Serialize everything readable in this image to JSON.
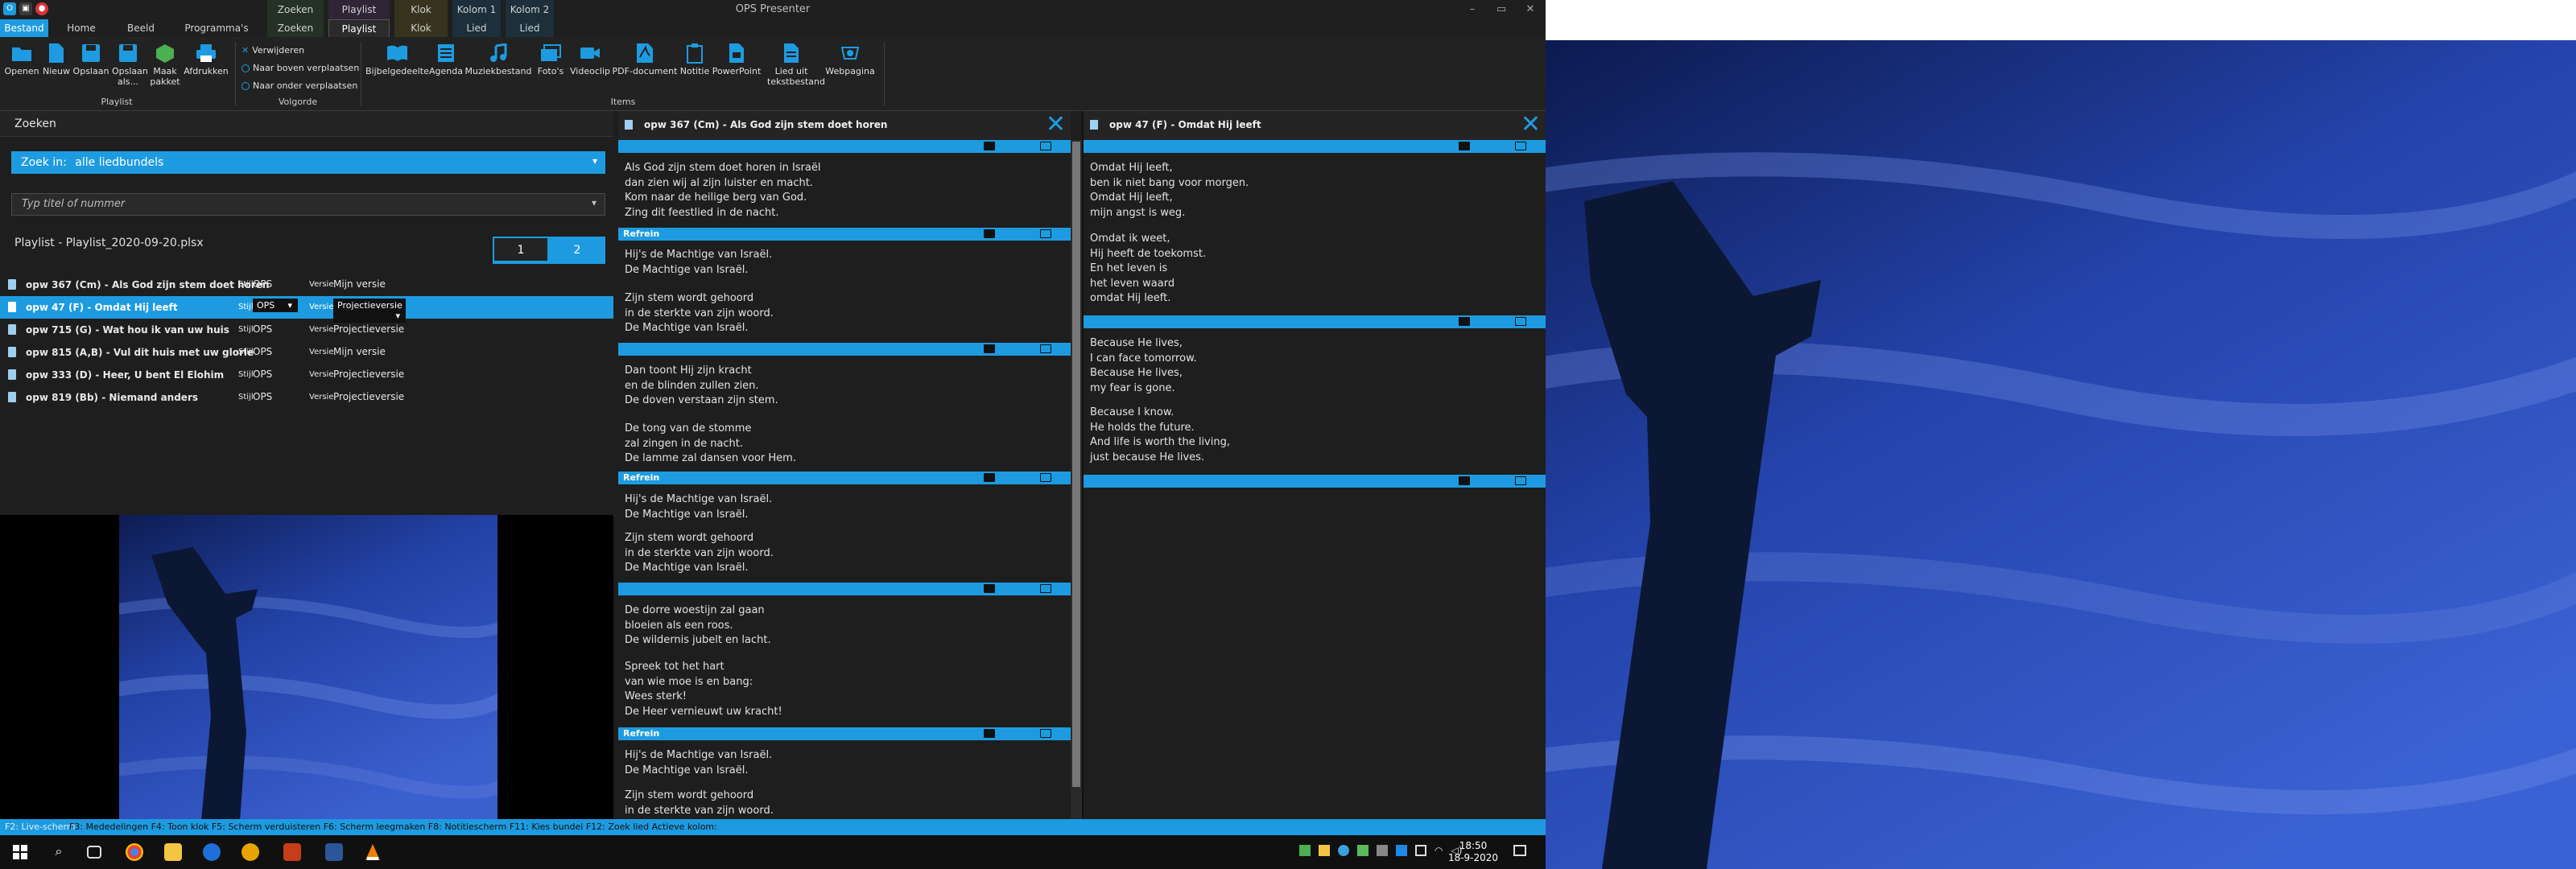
{
  "window": {
    "title": "OPS Presenter",
    "file_tab": "Bestand",
    "tabs": [
      "Home",
      "Beeld",
      "Programma's"
    ],
    "context_groups": [
      {
        "label": "Zoeken",
        "tab": "Zoeken"
      },
      {
        "label": "Playlist",
        "tab": "Playlist"
      },
      {
        "label": "Klok",
        "tab": "Klok"
      },
      {
        "label": "Kolom 1",
        "tab": "Lied"
      },
      {
        "label": "Kolom 2",
        "tab": "Lied"
      }
    ]
  },
  "ribbon": {
    "playlist_group": {
      "buttons": [
        "Openen",
        "Nieuw",
        "Opslaan",
        "Opslaan als...",
        "Maak pakket",
        "Afdrukken"
      ],
      "label": "Playlist"
    },
    "volgorde_group": {
      "buttons": [
        "Verwijderen",
        "Naar boven verplaatsen",
        "Naar onder verplaatsen"
      ],
      "label": "Volgorde"
    },
    "items_group": {
      "buttons": [
        "Bijbelgedeelte",
        "Agenda",
        "Muziekbestand",
        "Foto's",
        "Videoclip",
        "PDF-document",
        "Notitie",
        "PowerPoint",
        "Lied uit tekstbestand",
        "Webpagina"
      ],
      "label": "Items"
    }
  },
  "left_panel": {
    "header": "Zoeken",
    "zoek_in_label": "Zoek in:",
    "zoek_in_value": "alle liedbundels",
    "search_placeholder": "Typ titel of nummer",
    "playlist_title": "Playlist - Playlist_2020-09-20.plsx",
    "pages": [
      "1",
      "2"
    ],
    "stijl_label": "Stijl",
    "versie_label": "Versie",
    "items": [
      {
        "title": "opw 367 (Cm) - Als God zijn stem doet horen",
        "stijl": "OPS",
        "versie": "Mijn versie",
        "selected": false
      },
      {
        "title": "opw 47 (F) - Omdat Hij leeft",
        "stijl": "OPS",
        "versie": "Projectieversie",
        "selected": true
      },
      {
        "title": "opw 715 (G) - Wat hou ik van uw huis",
        "stijl": "OPS",
        "versie": "Projectieversie",
        "selected": false
      },
      {
        "title": "opw 815 (A,B) - Vul dit huis met uw glorie",
        "stijl": "OPS",
        "versie": "Mijn versie",
        "selected": false
      },
      {
        "title": "opw 333 (D) - Heer, U bent El Elohim",
        "stijl": "OPS",
        "versie": "Projectieversie",
        "selected": false
      },
      {
        "title": "opw 819 (Bb) - Niemand anders",
        "stijl": "OPS",
        "versie": "Projectieversie",
        "selected": false
      }
    ]
  },
  "column1": {
    "title": "opw 367 (Cm) - Als God zijn stem doet horen",
    "refrein_label": "Refrein",
    "verses": [
      "Als God zijn stem doet horen in Israël\ndan zien wij al zijn luister en macht.\nKom naar de heilige berg van God.\nZing dit feestlied in de nacht.",
      "Hij's de Machtige van Israël.\nDe Machtige van Israël.",
      "Zijn stem wordt gehoord\nin de sterkte van zijn woord.\nDe Machtige van Israël.",
      "Dan toont Hij zijn kracht\nen de blinden zullen zien.\nDe doven verstaan zijn stem.",
      "De tong van de stomme\nzal zingen in de nacht.\nDe lamme zal dansen voor Hem.",
      "Hij's de Machtige van Israël.\nDe Machtige van Israël.",
      "Zijn stem wordt gehoord\nin de sterkte van zijn woord.\nDe Machtige van Israël.",
      "De dorre woestijn zal gaan\nbloeien als een roos.\nDe wildernis jubelt en lacht.",
      "Spreek tot het hart\nvan wie moe is en bang:\nWees sterk!\nDe Heer vernieuwt uw kracht!",
      "Hij's de Machtige van Israël.\nDe Machtige van Israël.",
      "Zijn stem wordt gehoord\nin de sterkte van zijn woord."
    ]
  },
  "column2": {
    "title": "opw 47 (F) - Omdat Hij leeft",
    "verses": [
      "Omdat Hij leeft,\nben ik niet bang voor morgen.\nOmdat Hij leeft,\nmijn angst is weg.",
      "Omdat ik weet,\nHij heeft de toekomst.\nEn het leven is\nhet leven waard\nomdat Hij leeft.",
      "Because He lives,\nI can face tomorrow.\nBecause He lives,\nmy fear is gone.",
      "Because I know.\nHe holds the future.\nAnd life is worth the living,\njust because He lives."
    ]
  },
  "statusbar": {
    "f2": "F2: Live-scherm",
    "rest": "F3: Mededelingen  F4: Toon klok  F5: Scherm verduisteren  F6: Scherm leegmaken  F8: Notitiescherm  F11: Kies bundel  F12: Zoek lied  Actieve kolom:"
  },
  "taskbar": {
    "time": "18:50",
    "date": "18-9-2020"
  },
  "colors": {
    "accent": "#1e9be0",
    "background": "#1e1e1e",
    "cross": "#0c1733"
  }
}
